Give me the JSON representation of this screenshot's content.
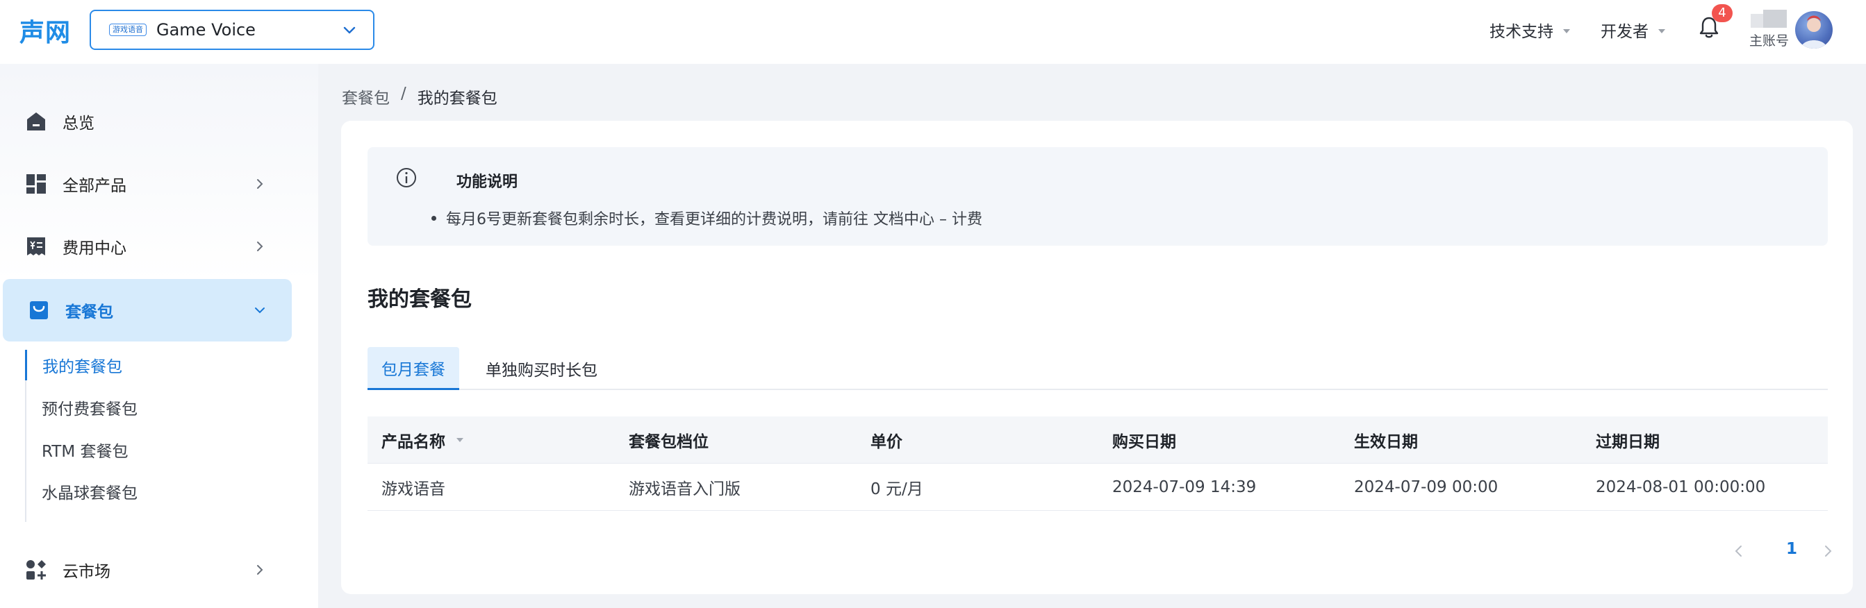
{
  "header": {
    "logo": "声网",
    "project": {
      "badge": "游戏语音",
      "name": "Game Voice"
    },
    "menus": [
      {
        "label": "技术支持"
      },
      {
        "label": "开发者"
      }
    ],
    "notification_count": "4",
    "account_label": "主账号"
  },
  "sidebar": {
    "items": [
      {
        "label": "总览",
        "icon": "home-icon"
      },
      {
        "label": "全部产品",
        "icon": "grid-icon"
      },
      {
        "label": "费用中心",
        "icon": "billing-icon"
      },
      {
        "label": "套餐包",
        "icon": "package-icon"
      },
      {
        "label": "云市场",
        "icon": "marketplace-icon"
      }
    ],
    "subitems": [
      {
        "label": "我的套餐包"
      },
      {
        "label": "预付费套餐包"
      },
      {
        "label": "RTM 套餐包"
      },
      {
        "label": "水晶球套餐包"
      }
    ]
  },
  "breadcrumb": {
    "parent": "套餐包",
    "separator": "/",
    "current": "我的套餐包"
  },
  "info": {
    "title": "功能说明",
    "bullet": "每月6号更新套餐包剩余时长，查看更详细的计费说明，请前往 文档中心 – 计费"
  },
  "section_title": "我的套餐包",
  "tabs": [
    {
      "label": "包月套餐"
    },
    {
      "label": "单独购买时长包"
    }
  ],
  "table": {
    "columns": [
      "产品名称",
      "套餐包档位",
      "单价",
      "购买日期",
      "生效日期",
      "过期日期"
    ],
    "rows": [
      [
        "游戏语音",
        "游戏语音入门版",
        "0 元/月",
        "2024-07-09 14:39",
        "2024-07-09 00:00",
        "2024-08-01 00:00:00"
      ]
    ]
  },
  "pagination": {
    "current_page": "1"
  },
  "colors": {
    "accent": "#1877d6",
    "active_bg": "#d6ebfc",
    "badge": "#f2544f"
  }
}
